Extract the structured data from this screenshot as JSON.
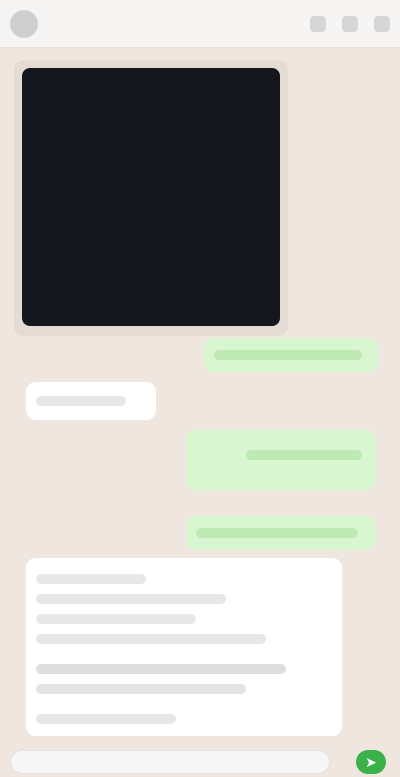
{
  "header": {
    "title": "",
    "icons": [
      "video-call-icon",
      "call-icon",
      "more-icon"
    ]
  },
  "chat": {
    "messages": [
      {
        "type": "image",
        "from": "in"
      },
      {
        "type": "text",
        "from": "out",
        "text": ""
      },
      {
        "type": "text",
        "from": "in",
        "text": ""
      },
      {
        "type": "text",
        "from": "out",
        "text": ""
      },
      {
        "type": "text",
        "from": "out",
        "text": ""
      },
      {
        "type": "text",
        "from": "in",
        "text": ""
      }
    ]
  },
  "composer": {
    "placeholder": "",
    "send_icon": "send-icon"
  }
}
